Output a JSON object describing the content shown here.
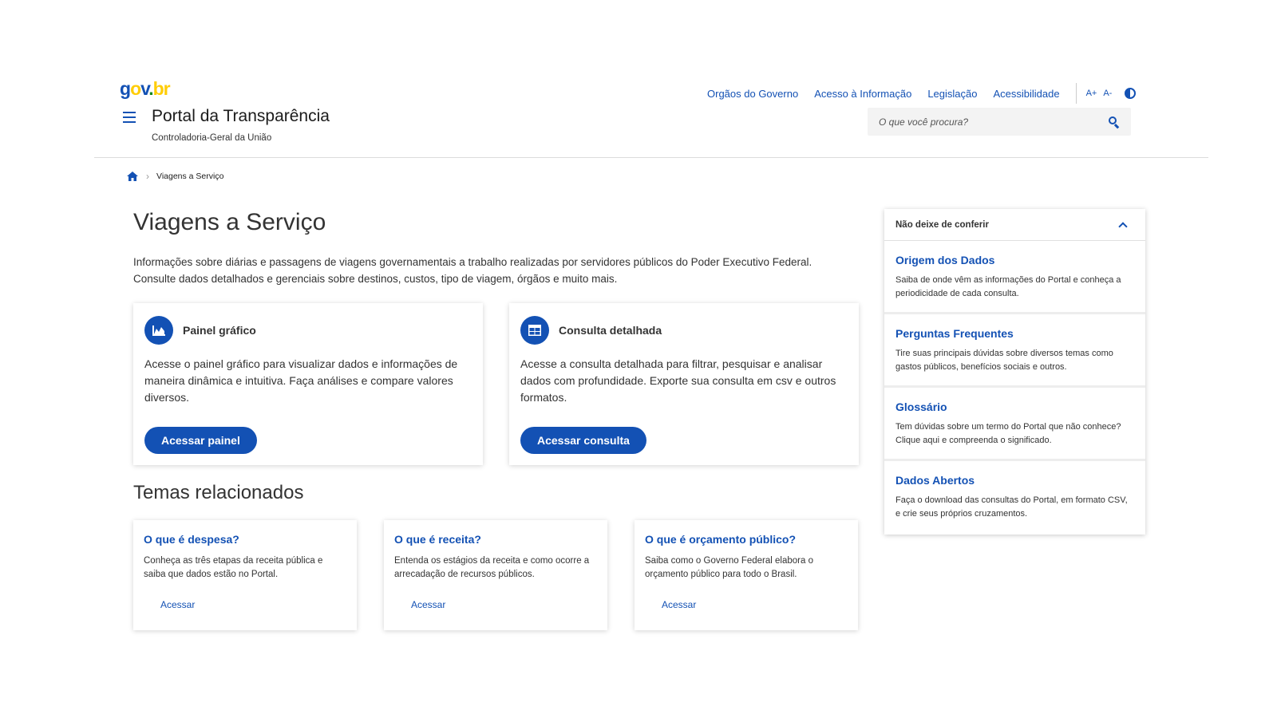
{
  "header": {
    "logo": {
      "g": "g",
      "o": "o",
      "v": "v",
      "dot": ".",
      "br": "br"
    },
    "nav": [
      "Orgãos do Governo",
      "Acesso à Informação",
      "Legislação",
      "Acessibilidade"
    ],
    "font_increase": "A+",
    "font_decrease": "A-",
    "contrast_icon": "contrast-icon",
    "site_title": "Portal da Transparência",
    "site_subtitle": "Controladoria-Geral da União",
    "search_placeholder": "O que você procura?"
  },
  "breadcrumb": {
    "home_icon": "home-icon",
    "current": "Viagens a Serviço"
  },
  "main": {
    "title": "Viagens a Serviço",
    "intro": "Informações sobre diárias e passagens de viagens governamentais a trabalho realizadas por servidores públicos do Poder Executivo Federal. Consulte dados detalhados e gerenciais sobre destinos, custos, tipo de viagem, órgãos e muito mais.",
    "cards": [
      {
        "icon": "chart-icon",
        "title": "Painel gráfico",
        "desc": "Acesse o painel gráfico para visualizar dados e informações de maneira dinâmica e intuitiva. Faça análises e compare valores diversos.",
        "button": "Acessar painel"
      },
      {
        "icon": "table-icon",
        "title": "Consulta detalhada",
        "desc": "Acesse a consulta detalhada para filtrar, pesquisar e analisar dados com profundidade. Exporte sua consulta em csv e outros formatos.",
        "button": "Acessar consulta"
      }
    ],
    "related_title": "Temas relacionados",
    "related": [
      {
        "title": "O que é despesa?",
        "desc": "Conheça as três etapas da receita pública e saiba que dados estão no Portal.",
        "link": "Acessar"
      },
      {
        "title": "O que é receita?",
        "desc": "Entenda os estágios da receita e como ocorre a arrecadação de recursos públicos.",
        "link": "Acessar"
      },
      {
        "title": "O que é orçamento público?",
        "desc": "Saiba como o Governo Federal elabora o orçamento público para todo o Brasil.",
        "link": "Acessar"
      }
    ]
  },
  "sidebar": {
    "title": "Não deixe de conferir",
    "items": [
      {
        "title": "Origem dos Dados",
        "desc": "Saiba de onde vêm as informações do Portal e conheça a periodicidade de cada consulta."
      },
      {
        "title": "Perguntas Frequentes",
        "desc": "Tire suas principais dúvidas sobre diversos temas como gastos públicos, benefícios sociais e outros."
      },
      {
        "title": "Glossário",
        "desc": "Tem dúvidas sobre um termo do Portal que não conhece? Clique aqui e compreenda o significado."
      },
      {
        "title": "Dados Abertos",
        "desc": "Faça o download das consultas do Portal, em formato CSV, e crie seus próprios cruzamentos."
      }
    ]
  },
  "colors": {
    "primary": "#1351b4",
    "govbr_yellow": "#ffcd07",
    "govbr_green": "#168821"
  }
}
